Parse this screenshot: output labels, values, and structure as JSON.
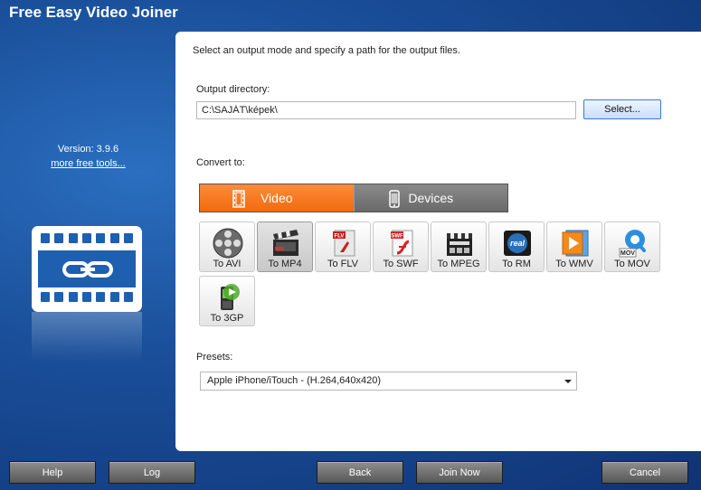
{
  "app": {
    "title": "Free Easy Video Joiner",
    "version": "Version: 3.9.6",
    "more_tools": "more free tools..."
  },
  "main": {
    "instruction": "Select an output mode and specify a path for the output files.",
    "output_directory": {
      "label": "Output directory:",
      "value": "C:\\SAJÁT\\képek\\",
      "select_label": "Select..."
    },
    "convert_to": {
      "label": "Convert to:",
      "tabs": [
        {
          "label": "Video",
          "active": true
        },
        {
          "label": "Devices",
          "active": false
        }
      ],
      "formats": [
        {
          "label": "To AVI",
          "icon": "film-reel-icon"
        },
        {
          "label": "To MP4",
          "icon": "clapperboard-icon",
          "selected": true
        },
        {
          "label": "To FLV",
          "icon": "flv-file-icon"
        },
        {
          "label": "To SWF",
          "icon": "swf-file-icon"
        },
        {
          "label": "To MPEG",
          "icon": "mpeg-clapper-icon"
        },
        {
          "label": "To RM",
          "icon": "real-media-icon"
        },
        {
          "label": "To WMV",
          "icon": "wmv-play-icon"
        },
        {
          "label": "To MOV",
          "icon": "quicktime-mov-icon"
        },
        {
          "label": "To 3GP",
          "icon": "3gp-phone-icon"
        }
      ]
    },
    "presets": {
      "label": "Presets:",
      "value": "Apple iPhone/iTouch - (H.264,640x420)"
    }
  },
  "footer": {
    "help": "Help",
    "log": "Log",
    "back": "Back",
    "join_now": "Join Now",
    "cancel": "Cancel"
  },
  "colors": {
    "background_blue": "#1a4f9a",
    "video_tab_orange": "#f06a0e",
    "devices_tab_gray": "#6a6a6a",
    "select_button_border": "#3b7bd0"
  }
}
